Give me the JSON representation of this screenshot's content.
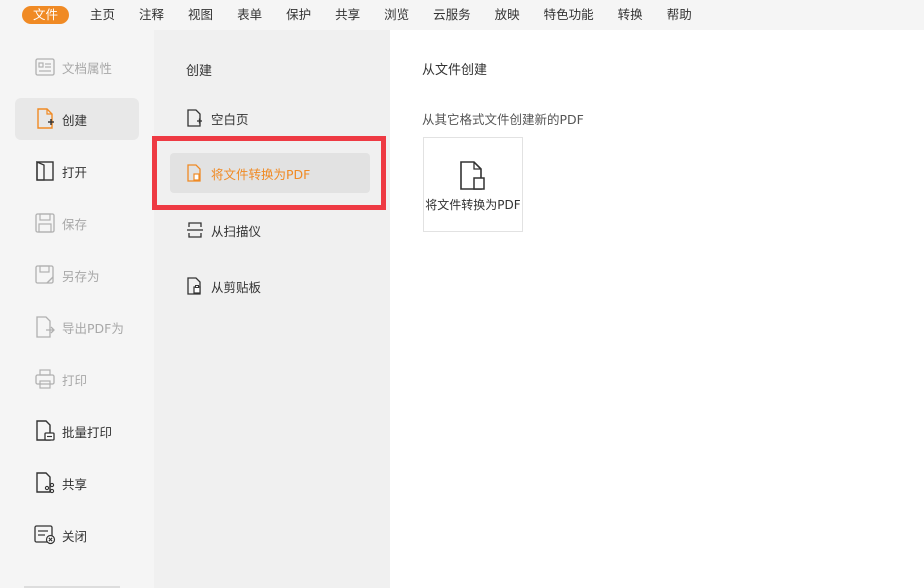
{
  "menubar": {
    "items": [
      {
        "label": "文件",
        "active": true
      },
      {
        "label": "主页"
      },
      {
        "label": "注释"
      },
      {
        "label": "视图"
      },
      {
        "label": "表单"
      },
      {
        "label": "保护"
      },
      {
        "label": "共享"
      },
      {
        "label": "浏览"
      },
      {
        "label": "云服务"
      },
      {
        "label": "放映"
      },
      {
        "label": "特色功能"
      },
      {
        "label": "转换"
      },
      {
        "label": "帮助"
      }
    ]
  },
  "left_nav": {
    "items": [
      {
        "label": "文档属性",
        "icon": "document-properties-icon",
        "state": "disabled"
      },
      {
        "label": "创建",
        "icon": "create-icon",
        "state": "selected"
      },
      {
        "label": "打开",
        "icon": "open-icon",
        "state": "normal"
      },
      {
        "label": "保存",
        "icon": "save-icon",
        "state": "disabled"
      },
      {
        "label": "另存为",
        "icon": "save-as-icon",
        "state": "disabled"
      },
      {
        "label": "导出PDF为",
        "icon": "export-pdf-icon",
        "state": "disabled"
      },
      {
        "label": "打印",
        "icon": "print-icon",
        "state": "disabled"
      },
      {
        "label": "批量打印",
        "icon": "batch-print-icon",
        "state": "normal"
      },
      {
        "label": "共享",
        "icon": "share-icon",
        "state": "normal"
      },
      {
        "label": "关闭",
        "icon": "close-doc-icon",
        "state": "normal"
      }
    ]
  },
  "middle": {
    "title": "创建",
    "items": [
      {
        "label": "空白页",
        "icon": "blank-page-icon"
      },
      {
        "label": "将文件转换为PDF",
        "icon": "convert-file-icon",
        "selected": true
      },
      {
        "label": "从扫描仪",
        "icon": "scanner-icon"
      },
      {
        "label": "从剪贴板",
        "icon": "clipboard-icon"
      }
    ]
  },
  "content": {
    "title": "从文件创建",
    "subtitle": "从其它格式文件创建新的PDF",
    "card_label": "将文件转换为PDF",
    "card_icon": "file-convert-icon"
  },
  "colors": {
    "accent": "#f08a24",
    "highlight_box": "#ee3a43"
  }
}
